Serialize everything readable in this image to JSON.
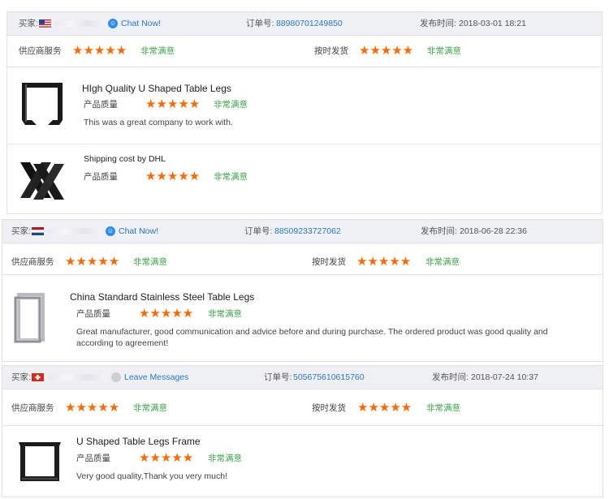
{
  "reviews": [
    {
      "buyer_label": "买家:",
      "buyer_name": "",
      "contact": "Chat Now!",
      "contact_icon": "chat-icon",
      "order_label": "订单号:",
      "order_number": "88980701249850",
      "date_label": "发布时间:",
      "date": "2018-03-01 18:21",
      "service_label": "供应商服务",
      "service_rating": "★★★★★",
      "service_text": "非常满意",
      "delivery_label": "按时发货",
      "delivery_rating": "★★★★★",
      "delivery_text": "非常满意",
      "products": [
        {
          "title": "HIgh Quality U Shaped Table Legs",
          "quality_label": "产品质量",
          "rating": "★★★★★",
          "rating_text": "非常满意",
          "comment": "This was a great company to work with."
        },
        {
          "title": "Shipping cost by DHL",
          "quality_label": "产品质量",
          "rating": "★★★★★",
          "rating_text": "非常满意",
          "comment": ""
        }
      ]
    },
    {
      "buyer_label": "买家:",
      "buyer_name": "",
      "contact": "Chat Now!",
      "contact_icon": "chat-icon",
      "order_label": "订单号:",
      "order_number": "88509233727062",
      "date_label": "发布时间:",
      "date": "2018-06-28 22:36",
      "service_label": "供应商服务",
      "service_rating": "★★★★★",
      "service_text": "非常满意",
      "delivery_label": "按时发货",
      "delivery_rating": "★★★★★",
      "delivery_text": "非常满意",
      "products": [
        {
          "title": "China Standard Stainless Steel Table Legs",
          "quality_label": "产品质量",
          "rating": "★★★★★",
          "rating_text": "非常满意",
          "comment": "Great manufacturer, good communication and advice before and during purchase. The ordered product was good quality and according to agreement!"
        }
      ]
    },
    {
      "buyer_label": "买家:",
      "buyer_name": "",
      "contact": "Leave Messages",
      "contact_icon": "message-icon",
      "order_label": "订单号:",
      "order_number": "505675610615760",
      "date_label": "发布时间:",
      "date": "2018-07-24 10:37",
      "service_label": "供应商服务",
      "service_rating": "★★★★★",
      "service_text": "非常满意",
      "delivery_label": "按时发货",
      "delivery_rating": "★★★★★",
      "delivery_text": "非常满意",
      "products": [
        {
          "title": "U Shaped Table Legs Frame",
          "quality_label": "产品质量",
          "rating": "★★★★★",
          "rating_text": "非常满意",
          "comment": "Very good quality,Thank you very much!"
        }
      ]
    }
  ],
  "colors": {
    "star": "#ff6a00",
    "satisfied": "#3da64a",
    "link": "#2c78c9",
    "header_bg": "#eef0f4"
  }
}
